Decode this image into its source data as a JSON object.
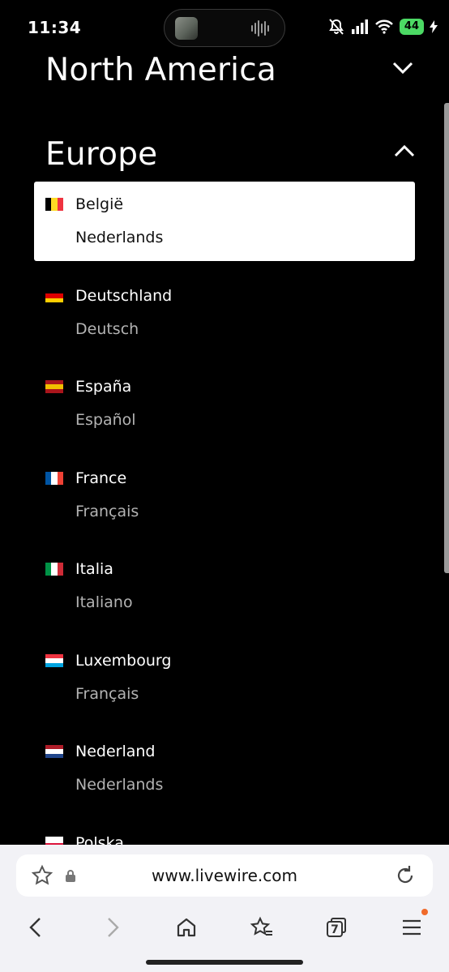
{
  "status": {
    "time": "11:34",
    "battery": "44"
  },
  "regions": {
    "north_america": "North America",
    "europe": "Europe"
  },
  "items": [
    {
      "country": "België",
      "language": "Nederlands",
      "flag": [
        "#000000",
        "#FDDA24",
        "#EF3340"
      ],
      "orient": "v"
    },
    {
      "country": "Deutschland",
      "language": "Deutsch",
      "flag": [
        "#000000",
        "#DD0000",
        "#FFCE00"
      ],
      "orient": "h"
    },
    {
      "country": "España",
      "language": "Español",
      "flag": [
        "#AA151B",
        "#F1BF00",
        "#AA151B"
      ],
      "orient": "h"
    },
    {
      "country": "France",
      "language": "Français",
      "flag": [
        "#0055A4",
        "#FFFFFF",
        "#EF4135"
      ],
      "orient": "v"
    },
    {
      "country": "Italia",
      "language": "Italiano",
      "flag": [
        "#009246",
        "#FFFFFF",
        "#CE2B37"
      ],
      "orient": "v"
    },
    {
      "country": "Luxembourg",
      "language": "Français",
      "flag": [
        "#EF3340",
        "#FFFFFF",
        "#00A3E0"
      ],
      "orient": "h"
    },
    {
      "country": "Nederland",
      "language": "Nederlands",
      "flag": [
        "#AE1C28",
        "#FFFFFF",
        "#21468B"
      ],
      "orient": "h"
    },
    {
      "country": "Polska",
      "language": "",
      "flag": [
        "#FFFFFF",
        "#DC143C"
      ],
      "orient": "h"
    }
  ],
  "browser": {
    "url": "www.livewire.com",
    "tab_count": "7"
  }
}
